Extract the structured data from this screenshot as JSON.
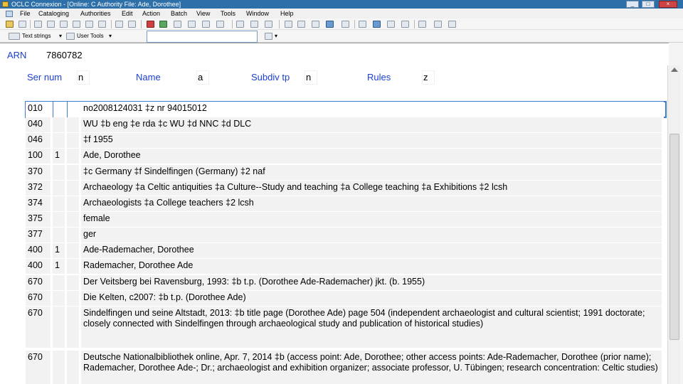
{
  "window": {
    "title": "OCLC Connexion - [Online: C Authority File: Ade, Dorothee]",
    "buttons": {
      "minimize": "_",
      "maximize": "□",
      "close": "×"
    }
  },
  "menu": [
    "File",
    "Cataloging",
    "Authorities",
    "Edit",
    "Action",
    "Batch",
    "View",
    "Tools",
    "Window",
    "Help"
  ],
  "toolbar": {
    "text_strings_label": "Text strings",
    "user_tools_label": "User Tools",
    "dropdown_arrow": "▾"
  },
  "header": {
    "arn_label": "ARN",
    "arn_value": "7860782",
    "fixed_fields": [
      {
        "label": "Ser num",
        "value": "n"
      },
      {
        "label": "Name",
        "value": "a"
      },
      {
        "label": "Subdiv tp",
        "value": "n"
      },
      {
        "label": "Rules",
        "value": "z"
      }
    ]
  },
  "fields": [
    {
      "tag": "010",
      "ind1": "",
      "ind2": "",
      "content": "no2008124031 ‡z nr 94015012",
      "selected": true
    },
    {
      "tag": "040",
      "ind1": "",
      "ind2": "",
      "content": "WU ‡b eng ‡e rda ‡c WU ‡d NNC ‡d DLC"
    },
    {
      "tag": "046",
      "ind1": "",
      "ind2": "",
      "content": "‡f 1955"
    },
    {
      "tag": "100",
      "ind1": "1",
      "ind2": "",
      "content": "Ade, Dorothee"
    },
    {
      "tag": "370",
      "ind1": "",
      "ind2": "",
      "content": "‡c Germany ‡f Sindelfingen (Germany) ‡2 naf"
    },
    {
      "tag": "372",
      "ind1": "",
      "ind2": "",
      "content": "Archaeology ‡a Celtic antiquities ‡a Culture--Study and teaching ‡a College teaching ‡a Exhibitions ‡2 lcsh"
    },
    {
      "tag": "374",
      "ind1": "",
      "ind2": "",
      "content": "Archaeologists ‡a College teachers ‡2 lcsh"
    },
    {
      "tag": "375",
      "ind1": "",
      "ind2": "",
      "content": "female"
    },
    {
      "tag": "377",
      "ind1": "",
      "ind2": "",
      "content": "ger"
    },
    {
      "tag": "400",
      "ind1": "1",
      "ind2": "",
      "content": "Ade-Rademacher, Dorothee"
    },
    {
      "tag": "400",
      "ind1": "1",
      "ind2": "",
      "content": "Rademacher, Dorothee Ade"
    },
    {
      "tag": "670",
      "ind1": "",
      "ind2": "",
      "content": "Der Veitsberg bei Ravensburg, 1993: ‡b t.p. (Dorothee Ade-Rademacher) jkt. (b. 1955)"
    },
    {
      "tag": "670",
      "ind1": "",
      "ind2": "",
      "content": "Die Kelten, c2007: ‡b t.p. (Dorothee Ade)"
    },
    {
      "tag": "670",
      "ind1": "",
      "ind2": "",
      "content": "Sindelfingen und seine Altstadt, 2013: ‡b title page (Dorothee Ade) page 504 (independent archaeologist and cultural scientist; 1991 doctorate; closely connected with Sindelfingen through archaeological study and publication of historical studies)"
    },
    {
      "tag": "670",
      "ind1": "",
      "ind2": "",
      "content": "Deutsche Nationalbibliothek online, Apr. 7, 2014 ‡b (access point: Ade, Dorothee; other access points: Ade-Rademacher, Dorothee (prior name); Rademacher, Dorothee Ade-; Dr.; archaeologist and exhibition organizer; associate professor, U. Tübingen; research concentration: Celtic studies)"
    }
  ]
}
